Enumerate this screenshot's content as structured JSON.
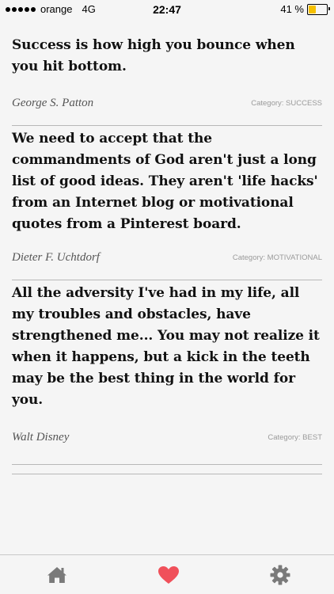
{
  "status_bar": {
    "carrier": "orange",
    "network": "4G",
    "time": "22:47",
    "battery_percent": "41 %",
    "battery_level": 0.41,
    "battery_color": "#f5c000"
  },
  "quotes": [
    {
      "text": "Success is how high you bounce when you hit bottom.",
      "author": "George S. Patton",
      "category": "Category: SUCCESS"
    },
    {
      "text": "We need to accept that the commandments of God aren't just a long list of good ideas. They aren't 'life hacks' from an Internet blog or motivational quotes from a Pinterest board.",
      "author": "Dieter F. Uchtdorf",
      "category": "Category: MOTIVATIONAL"
    },
    {
      "text": "All the adversity I've had in my life, all my troubles and obstacles, have strengthened me... You may not realize it when it happens, but a kick in the teeth may be the best thing in the world for you.",
      "author": "Walt Disney",
      "category": "Category: BEST"
    }
  ],
  "tab_bar": {
    "tabs": [
      {
        "icon": "home-icon",
        "color": "#7a7a7a"
      },
      {
        "icon": "heart-icon",
        "color": "#f0505a"
      },
      {
        "icon": "gear-icon",
        "color": "#7a7a7a"
      }
    ],
    "active_color": "#f0505a"
  }
}
